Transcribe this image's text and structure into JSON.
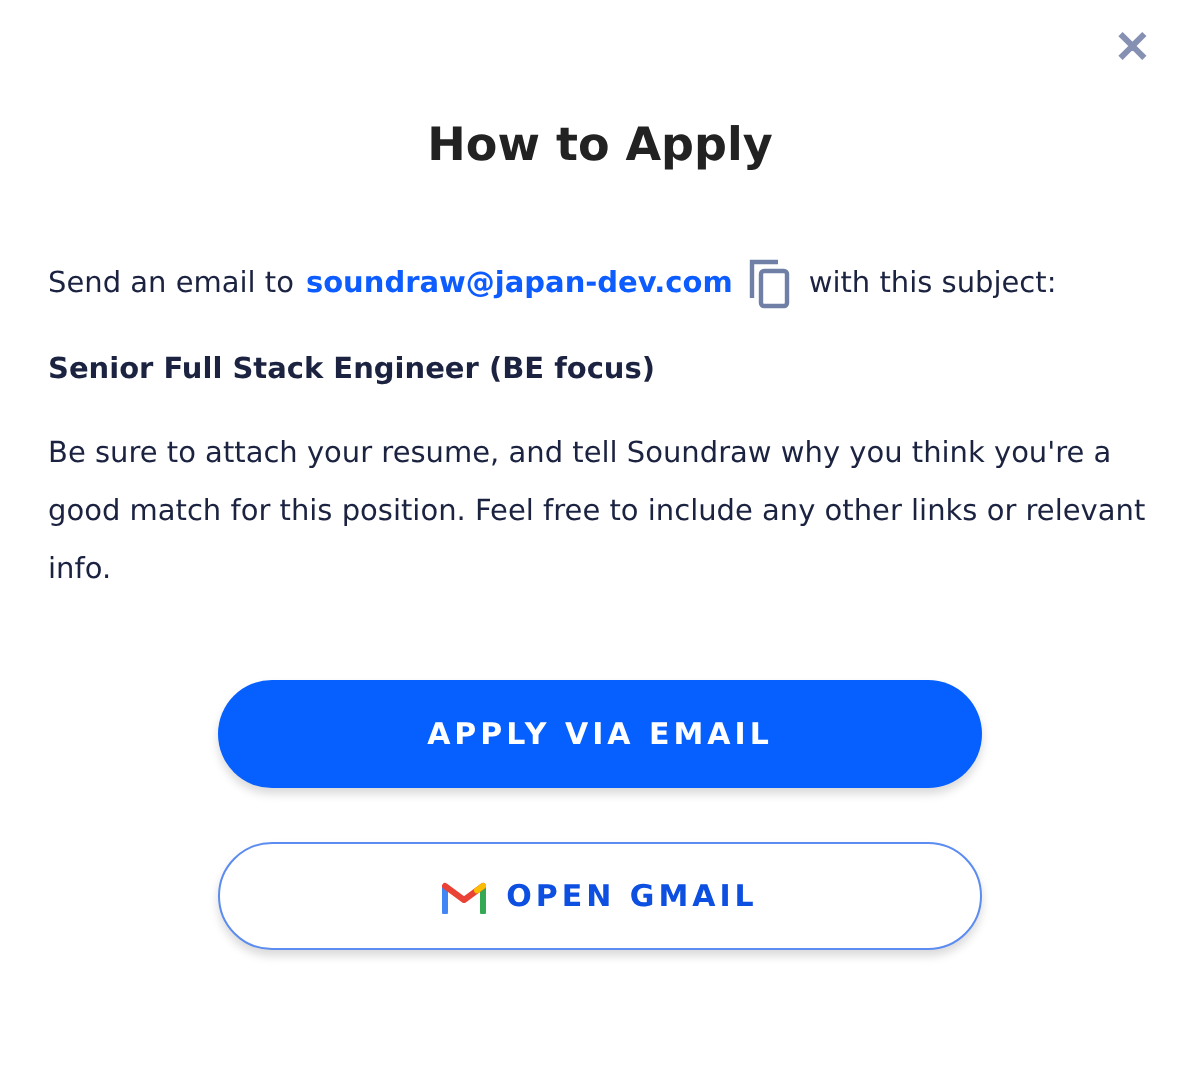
{
  "close_button": {
    "label": "✕"
  },
  "title": "How to Apply",
  "instruction": {
    "before": "Send an email to",
    "email": "soundraw@japan-dev.com",
    "after": "with this subject:"
  },
  "subject": "Senior Full Stack Engineer (BE focus)",
  "description": "Be sure to attach your resume, and tell Soundraw why you think you're a good match for this position. Feel free to include any other links or relevant info.",
  "buttons": [
    {
      "kind": "primary",
      "label": "APPLY VIA EMAIL"
    },
    {
      "kind": "gmail",
      "label": "OPEN GMAIL"
    }
  ]
}
